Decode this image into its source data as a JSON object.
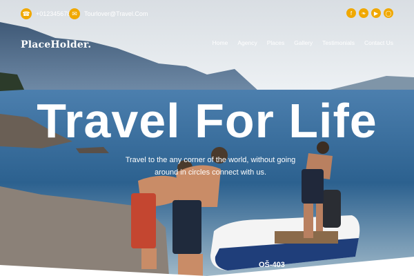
{
  "topbar": {
    "phone": "+0123456789",
    "email": "Tourlover@Travel.Com",
    "socials": [
      "facebook-icon",
      "twitter-icon",
      "youtube-icon",
      "instagram-icon"
    ]
  },
  "brand": "PlaceHolder.",
  "nav": [
    "Home",
    "Agency",
    "Places",
    "Gallery",
    "Testimonials",
    "Contact Us"
  ],
  "hero": {
    "headline": "Travel For Life",
    "subtitle": "Travel to the any corner of the world, without going around in circles connect with us."
  },
  "boat": {
    "label": "OŠ-403"
  },
  "colors": {
    "accent": "#f0a800",
    "sea": "#2f6fa5",
    "sky": "#e6eef4"
  }
}
